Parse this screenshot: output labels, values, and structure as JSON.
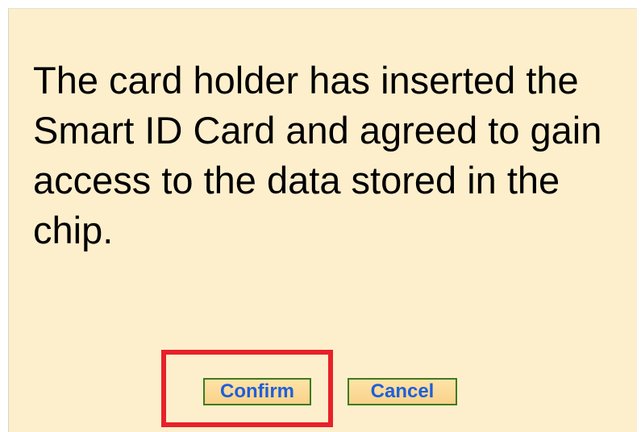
{
  "dialog": {
    "message": "The card holder has inserted the Smart ID Card and agreed to gain access to the data stored in the chip.",
    "confirm_label": "Confirm",
    "cancel_label": "Cancel"
  },
  "colors": {
    "background": "#fdefcc",
    "button_text": "#1f5fd8",
    "button_border": "#3f7a22",
    "highlight": "#e8212a"
  }
}
